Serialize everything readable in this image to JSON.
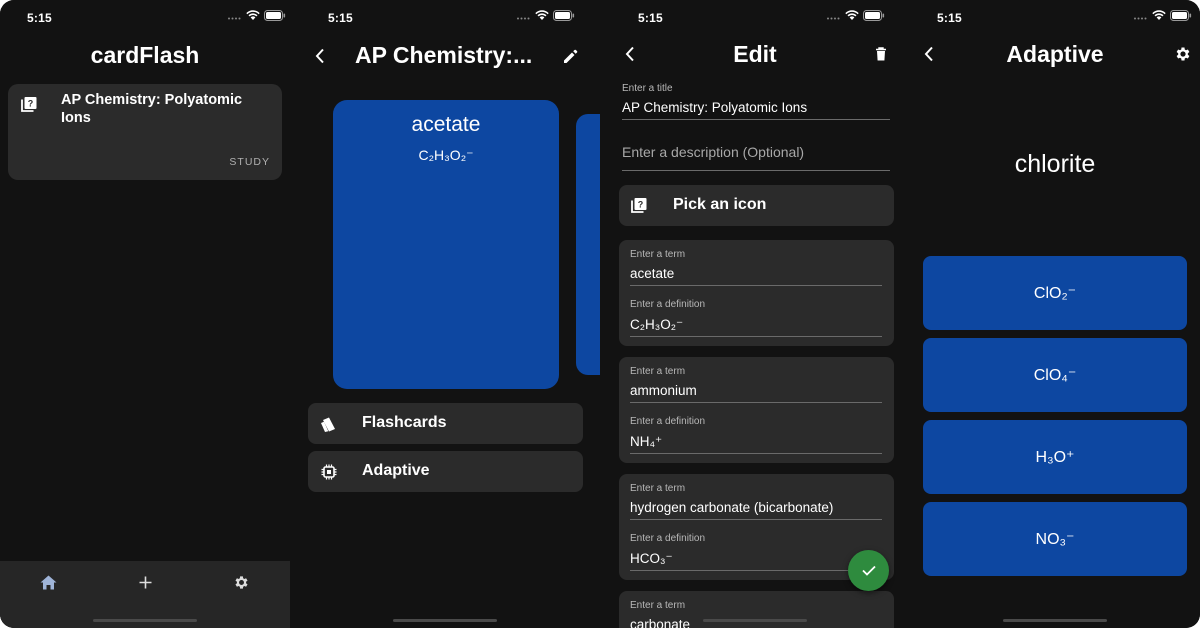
{
  "status": {
    "time": "5:15"
  },
  "screen1": {
    "title": "cardFlash",
    "deck": {
      "title": "AP Chemistry: Polyatomic Ions",
      "action": "STUDY",
      "icon": "help-book-icon"
    },
    "tabs": [
      {
        "name": "home",
        "icon": "home-icon"
      },
      {
        "name": "add",
        "icon": "plus-icon"
      },
      {
        "name": "settings",
        "icon": "gear-icon"
      }
    ]
  },
  "screen2": {
    "title": "AP Chemistry:...",
    "card": {
      "term": "acetate",
      "definition": "C₂H₃O₂⁻"
    },
    "modes": [
      {
        "label": "Flashcards",
        "icon": "cards-icon"
      },
      {
        "label": "Adaptive",
        "icon": "chip-icon"
      }
    ]
  },
  "screen3": {
    "title": "Edit",
    "title_field": {
      "label": "Enter a title",
      "value": "AP Chemistry: Polyatomic Ions"
    },
    "description_field": {
      "placeholder": "Enter a description (Optional)"
    },
    "icon_button": "Pick an icon",
    "term_label": "Enter a term",
    "definition_label": "Enter a definition",
    "cards": [
      {
        "term": "acetate",
        "definition": "C₂H₃O₂⁻"
      },
      {
        "term": "ammonium",
        "definition": "NH₄⁺"
      },
      {
        "term": "hydrogen carbonate (bicarbonate)",
        "definition": "HCO₃⁻"
      },
      {
        "term": "carbonate",
        "definition": ""
      }
    ]
  },
  "screen4": {
    "title": "Adaptive",
    "question": "chlorite",
    "answers": [
      "ClO₂⁻",
      "ClO₄⁻",
      "H₃O⁺",
      "NO₃⁻"
    ]
  },
  "colors": {
    "background": "#121212",
    "surface": "#2b2b2b",
    "card_blue": "#0d47a1",
    "fab_green": "#2e8b3e"
  }
}
